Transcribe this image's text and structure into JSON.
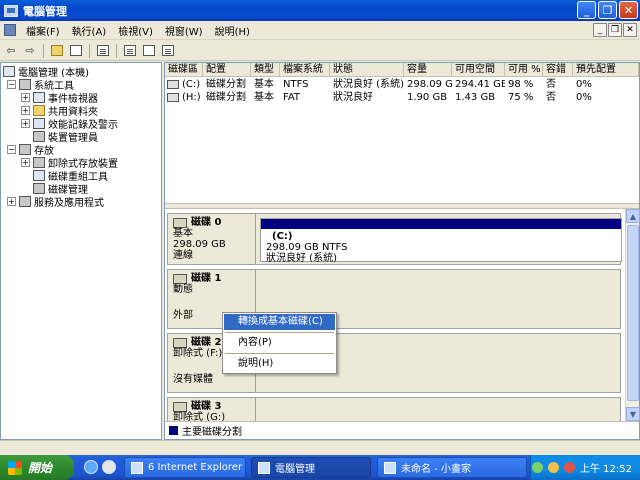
{
  "window": {
    "title": "電腦管理"
  },
  "menu": [
    "檔案(F)",
    "執行(A)",
    "檢視(V)",
    "視窗(W)",
    "說明(H)"
  ],
  "tree": [
    {
      "label": "電腦管理 (本機)",
      "expander": ""
    },
    {
      "label": "系統工具",
      "expander": "−"
    },
    {
      "label": "事件檢視器",
      "expander": "+"
    },
    {
      "label": "共用資料夾",
      "expander": "+"
    },
    {
      "label": "效能記錄及警示",
      "expander": "+"
    },
    {
      "label": "裝置管理員",
      "expander": ""
    },
    {
      "label": "存放",
      "expander": "−"
    },
    {
      "label": "卸除式存放裝置",
      "expander": "+"
    },
    {
      "label": "磁碟重組工具",
      "expander": ""
    },
    {
      "label": "磁碟管理",
      "expander": ""
    },
    {
      "label": "服務及應用程式",
      "expander": "+"
    }
  ],
  "volume_list": {
    "headers": [
      "磁碟區",
      "配置",
      "類型",
      "檔案系統",
      "狀態",
      "容量",
      "可用空間",
      "可用 %",
      "容錯",
      "預先配置"
    ],
    "rows": [
      [
        "(C:)",
        "磁碟分割",
        "基本",
        "NTFS",
        "狀況良好 (系統)",
        "298.09 GB",
        "294.41 GB",
        "98 %",
        "否",
        "0%"
      ],
      [
        "(H:)",
        "磁碟分割",
        "基本",
        "FAT",
        "狀況良好",
        "1.90 GB",
        "1.43 GB",
        "75 %",
        "否",
        "0%"
      ]
    ]
  },
  "disks": [
    {
      "name": "磁碟 0",
      "line1": "基本",
      "line2": "298.09 GB",
      "line3": "連線",
      "partition": {
        "label": "(C:)",
        "detail": "298.09 GB NTFS",
        "status": "狀況良好 (系統)"
      }
    },
    {
      "name": "磁碟 1",
      "line1": "動態",
      "line2": "",
      "line3": "外部"
    },
    {
      "name": "磁碟 2",
      "line1": "卸除式 (F:)",
      "line2": "",
      "line3": "沒有媒體"
    },
    {
      "name": "磁碟 3",
      "line1": "卸除式 (G:)"
    }
  ],
  "legend": "主要磁碟分割",
  "context_menu": [
    "轉換成基本磁碟(C)",
    "內容(P)",
    "說明(H)"
  ],
  "taskbar": {
    "start": "開始",
    "tasks": [
      "6 Internet Explorer",
      "電腦管理",
      "未命名 - 小畫家"
    ],
    "clock": "上午 12:52"
  },
  "colors": {
    "primary_partition": "#000080",
    "selection": "#316ac5"
  }
}
